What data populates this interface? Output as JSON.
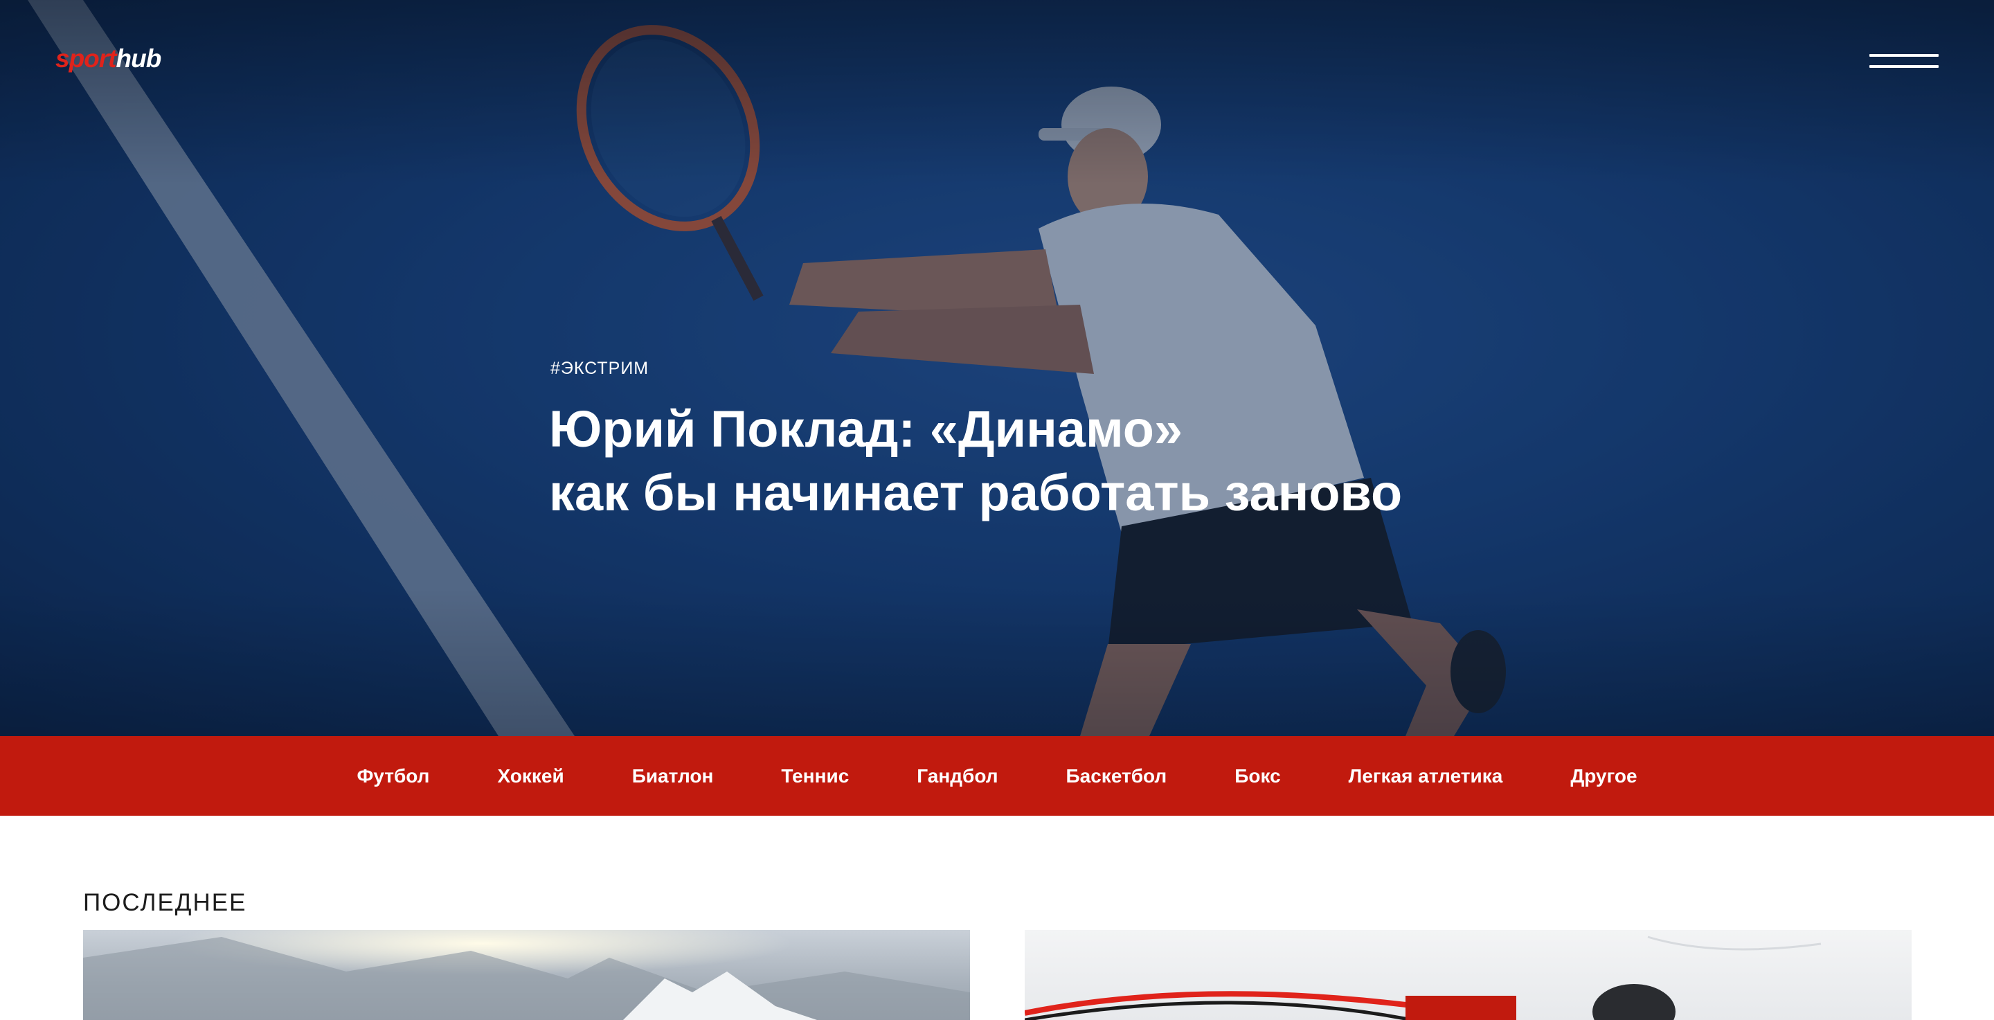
{
  "brand": {
    "part1": "sport",
    "part2": "hub"
  },
  "hero": {
    "tag": "#ЭКСТРИМ",
    "title_line1": "Юрий Поклад: «Динамо»",
    "title_line2": "как бы начинает работать заново"
  },
  "nav": {
    "items": [
      "Футбол",
      "Хоккей",
      "Биатлон",
      "Теннис",
      "Гандбол",
      "Баскетбол",
      "Бокс",
      "Легкая атлетика",
      "Другое"
    ]
  },
  "latest": {
    "title": "ПОСЛЕДНЕЕ"
  },
  "icons": {
    "menu": "hamburger-icon"
  },
  "colors": {
    "brand_red": "#e0231b",
    "nav_red": "#c11a0e",
    "hero_blue": "#173e76"
  }
}
